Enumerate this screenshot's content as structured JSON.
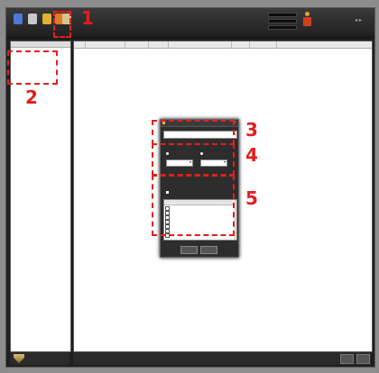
{
  "toolbar": {
    "buttons": [
      {
        "label": "",
        "icon": "monitor-icon",
        "color": "#4a7bd6"
      },
      {
        "label": "",
        "icon": "file-icon",
        "color": "#c9c9c9"
      },
      {
        "label": "",
        "icon": "pen-icon",
        "color": "#e0b030"
      },
      {
        "label": "",
        "icon": "folder-icon",
        "color": "#e07b2a"
      },
      {
        "label": "",
        "icon": "log-icon",
        "color": "#d8c48a"
      }
    ],
    "meters": [
      "",
      "",
      ""
    ],
    "info_lines": [
      "",
      "",
      ""
    ]
  },
  "left_panel": {
    "tree": {
      "root": "",
      "children": [
        "",
        "",
        "",
        ""
      ]
    }
  },
  "main": {
    "title": "",
    "columns": [
      "",
      "",
      "",
      "",
      "",
      "",
      "",
      ""
    ]
  },
  "bottom": {
    "btn1": "",
    "btn2": ""
  },
  "dialog": {
    "title": "",
    "select_value": "",
    "group1_label": "",
    "radio1": "",
    "radio2": "",
    "spin1": "",
    "spin2": "",
    "group2_label": "",
    "list_label": "",
    "list_header": {
      "a": "",
      "b": ""
    },
    "list_rows": [
      {
        "a": "",
        "b": ""
      },
      {
        "a": "",
        "b": ""
      },
      {
        "a": "",
        "b": ""
      },
      {
        "a": "",
        "b": ""
      },
      {
        "a": "",
        "b": ""
      },
      {
        "a": "",
        "b": ""
      },
      {
        "a": "",
        "b": ""
      }
    ],
    "ok_label": "",
    "cancel_label": ""
  },
  "annotations": {
    "n1": "1",
    "n2": "2",
    "n3": "3",
    "n4": "4",
    "n5": "5",
    "color": "#e02020"
  }
}
